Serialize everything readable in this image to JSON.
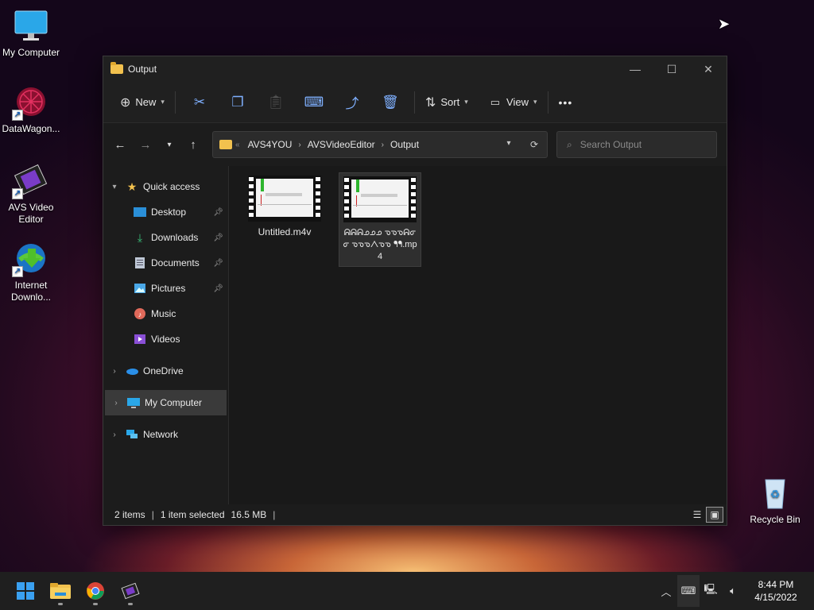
{
  "desktop": {
    "icons": [
      {
        "label": "My Computer",
        "icon": "monitor-icon"
      },
      {
        "label": "DataWagon...",
        "icon": "datawagon-icon"
      },
      {
        "label": "AVS Video Editor",
        "icon": "avs-video-editor-icon"
      },
      {
        "label": "Internet Downlo...",
        "icon": "internet-download-manager-icon"
      }
    ],
    "recycle_bin": "Recycle Bin"
  },
  "window": {
    "title": "Output",
    "controls": {
      "minimize": "—",
      "maximize": "☐",
      "close": "✕"
    },
    "toolbar": {
      "new_label": "New",
      "sort_label": "Sort",
      "view_label": "View",
      "more_label": "•••"
    },
    "address": {
      "crumbs": [
        "AVS4YOU",
        "AVSVideoEditor",
        "Output"
      ]
    },
    "search": {
      "placeholder": "Search Output"
    },
    "nav": {
      "quick_access": "Quick access",
      "items": [
        {
          "label": "Desktop",
          "icon": "desktop-icon"
        },
        {
          "label": "Downloads",
          "icon": "downloads-icon"
        },
        {
          "label": "Documents",
          "icon": "documents-icon"
        },
        {
          "label": "Pictures",
          "icon": "pictures-icon"
        },
        {
          "label": "Music",
          "icon": "music-icon"
        },
        {
          "label": "Videos",
          "icon": "videos-icon"
        }
      ],
      "onedrive": "OneDrive",
      "my_computer": "My Computer",
      "network": "Network"
    },
    "files": [
      {
        "name": "Untitled.m4v",
        "selected": false
      },
      {
        "name": "ᕱᕱᕱᓄᓄᓄ ᓀᓀᓀᕱᓂᓂ ᓀᓀᓀᐱᓀᓀ ᖳᖳ.mp4",
        "selected": true
      }
    ],
    "status": {
      "count": "2 items",
      "selection": "1 item selected",
      "size": "16.5 MB"
    }
  },
  "taskbar": {
    "time": "8:44 PM",
    "date": "4/15/2022"
  }
}
